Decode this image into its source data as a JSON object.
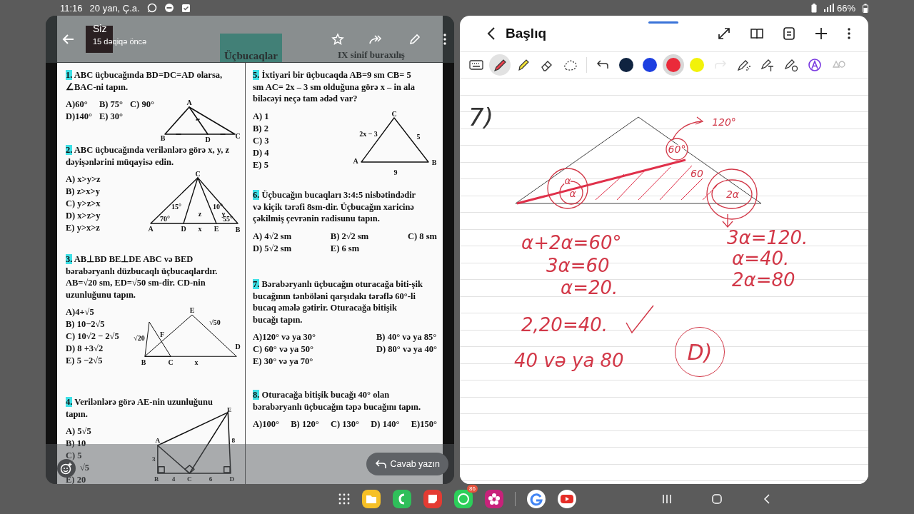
{
  "status_bar": {
    "time": "11:16",
    "date": "20 yan, Ç.a.",
    "battery": "66%"
  },
  "viewer": {
    "sender": "Siz",
    "time_ago": "15 dəqiqə öncə",
    "reply_button": "Cavab yazın"
  },
  "document": {
    "title": "Üçbucaqlar",
    "subtitle": "IX sinif buraxılış",
    "columns": [
      [
        {
          "number": "1.",
          "text": "ABC üçbucağında BD=DC=AD olarsa, ∠BAC-ni tapın.",
          "option_rows": [
            {
              "options": [
                "A)60°",
                "B) 75°",
                "C) 90°"
              ]
            },
            {
              "options": [
                "D)140°",
                "E) 30°"
              ]
            }
          ],
          "figure": {
            "kind": "median",
            "labels": [
              "A",
              "B",
              "D",
              "C"
            ]
          }
        },
        {
          "number": "2.",
          "text": "ABC üçbucağında verilənlərə görə x, y, z dəyişənlərini müqayisə edin.",
          "option_rows": [
            {
              "options": [
                "A) x>y>z"
              ]
            },
            {
              "options": [
                "B) z>x>y"
              ]
            },
            {
              "options": [
                "C) y>z>x"
              ]
            },
            {
              "options": [
                "D) x>z>y"
              ]
            },
            {
              "options": [
                "E) y>x>z"
              ]
            }
          ],
          "figure": {
            "kind": "cevians",
            "labels": [
              "C",
              "15°",
              "10°",
              "z",
              "y",
              "70°",
              "55°",
              "A",
              "D",
              "x",
              "E",
              "B"
            ]
          }
        },
        {
          "number": "3.",
          "text": "AB⊥BD BE⊥DE ABC və BED bərabəryanlı düzbucaqlı üçbucaqlardır. AB=√20 sm, ED=√50 sm-dir. CD-nin uzunluğunu tapın.",
          "option_rows": [
            {
              "options": [
                "A)4+√5"
              ]
            },
            {
              "options": [
                "B) 10−2√5"
              ]
            },
            {
              "options": [
                "C) 10√2 − 2√5"
              ]
            },
            {
              "options": [
                "D) 8 +3√2"
              ]
            },
            {
              "options": [
                "E) 5 −2√5"
              ]
            }
          ],
          "figure": {
            "kind": "overlap",
            "labels": [
              "E",
              "√50",
              "F",
              "√20",
              "D",
              "B",
              "C",
              "x"
            ]
          }
        },
        {
          "number": "4.",
          "text": "Verilənlərə görə AE-nin uzunluğunu tapın.",
          "option_rows": [
            {
              "options": [
                "A) 5√5"
              ]
            },
            {
              "options": [
                "B) 10"
              ]
            },
            {
              "options": [
                "C) 5"
              ]
            },
            {
              "options": [
                "√5"
              ],
              "covered": true
            },
            {
              "options": [
                "E) 20"
              ]
            }
          ],
          "figure": {
            "kind": "right_angles",
            "labels": [
              "E",
              "A",
              "8",
              "3",
              "B",
              "4",
              "C",
              "6",
              "D"
            ]
          }
        }
      ],
      [
        {
          "number": "5.",
          "text": "İxtiyari bir üçbucaqda AB=9 sm CB= 5 sm AC= 2x – 3 sm olduğuna görə x – in ala biləcəyi neçə tam ədəd var?",
          "option_rows": [
            {
              "options": [
                "A) 1"
              ]
            },
            {
              "options": [
                "B) 2"
              ]
            },
            {
              "options": [
                "C) 3"
              ]
            },
            {
              "options": [
                "D) 4"
              ]
            },
            {
              "options": [
                "E) 5"
              ]
            }
          ],
          "figure": {
            "kind": "plain",
            "labels": [
              "C",
              "2x − 3",
              "5",
              "A",
              "B",
              "9"
            ]
          }
        },
        {
          "number": "6.",
          "text": "Üçbucağın bucaqları 3:4:5 nisbətindədir və kiçik tərəfi 8sm-dir. Üçbucağın xaricinə çəkilmiş çevrənin radisunu tapın.",
          "option_rows": [
            {
              "options": [
                "A) 4√2 sm",
                "B) 2√2 sm",
                "C) 8 sm"
              ]
            },
            {
              "options": [
                "D) 5√2 sm",
                "E) 6 sm"
              ]
            }
          ]
        },
        {
          "number": "7.",
          "text": "Bərabəryanlı üçbucağın oturacağa biti-şik bucağının tənböləni qarşıdakı tərəflə 60°-li bucaq əmələ gətirir. Oturacağa bitişik bucağı tapın.",
          "option_rows": [
            {
              "options": [
                "A)120° və ya 30°",
                "B) 40° və ya 85°"
              ]
            },
            {
              "options": [
                "C) 60° və ya 50°",
                "D) 80° və ya 40°"
              ]
            },
            {
              "options": [
                "E) 30° və ya 70°"
              ]
            }
          ]
        },
        {
          "number": "8.",
          "text": "Oturacağa bitişik bucağı 40° olan bərabəryanlı üçbucağın təpə bucağını tapın.",
          "option_rows": [
            {
              "options": [
                "A)100°",
                "B) 120°",
                "C) 130°",
                "D) 140°",
                "E)150°"
              ]
            }
          ]
        }
      ]
    ]
  },
  "notebook": {
    "title": "Başlıq",
    "tools_left": [
      {
        "kind": "keyboard",
        "selected": false,
        "disabled": false
      },
      {
        "kind": "pen",
        "selected": true,
        "disabled": false
      },
      {
        "kind": "highlighter",
        "selected": false,
        "disabled": false
      },
      {
        "kind": "eraser",
        "selected": false,
        "disabled": false
      },
      {
        "kind": "lasso",
        "selected": false,
        "disabled": false
      },
      {
        "kind": "undo",
        "selected": false,
        "disabled": false
      }
    ],
    "colors": [
      {
        "color": "#0f2340",
        "selected": false
      },
      {
        "color": "#1d3fe0",
        "selected": false
      },
      {
        "color": "#ea2a3a",
        "selected": true
      },
      {
        "color": "#f2f20a",
        "selected": false
      }
    ],
    "tools_right": [
      {
        "kind": "redo",
        "selected": false,
        "disabled": true
      },
      {
        "kind": "pen_effect",
        "selected": false,
        "disabled": false
      },
      {
        "kind": "pen_text",
        "selected": false,
        "disabled": false
      },
      {
        "kind": "pen_stamp",
        "selected": false,
        "disabled": false
      },
      {
        "kind": "text_style",
        "selected": false,
        "disabled": false
      },
      {
        "kind": "shape",
        "selected": false,
        "disabled": false
      }
    ],
    "problem_number": "7)",
    "sketch_labels": [
      "120°",
      "60°",
      "60",
      "α",
      "α",
      "2α"
    ],
    "notes": [
      {
        "kind": "equation",
        "text": "α+2α=60°"
      },
      {
        "kind": "equation",
        "text": "3α=120."
      },
      {
        "kind": "equation",
        "text": "3α=60"
      },
      {
        "kind": "equation",
        "text": "α=40."
      },
      {
        "kind": "equation",
        "text": "α=20."
      },
      {
        "kind": "equation",
        "text": "2α=80"
      },
      {
        "kind": "checked",
        "text": "2,20=40."
      },
      {
        "kind": "equation",
        "text": "40 və ya 80"
      },
      {
        "kind": "circled",
        "text": "D)"
      }
    ]
  },
  "taskbar": {
    "apps": [
      {
        "kind": "files"
      },
      {
        "kind": "phone"
      },
      {
        "kind": "notes"
      },
      {
        "kind": "whatsapp",
        "badge": "86"
      },
      {
        "kind": "flower"
      },
      {
        "kind": "google"
      },
      {
        "kind": "youtube"
      }
    ]
  }
}
